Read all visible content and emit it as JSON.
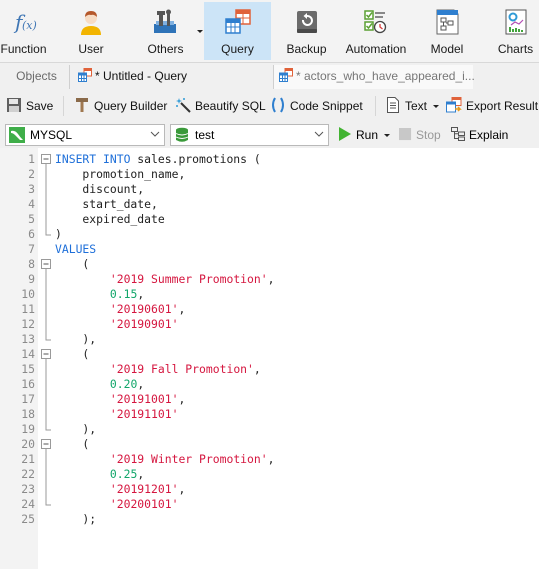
{
  "ribbon": {
    "items": [
      {
        "label": "Function",
        "icon": "function-icon"
      },
      {
        "label": "User",
        "icon": "user-icon"
      },
      {
        "label": "Others",
        "icon": "others-tools-icon"
      },
      {
        "label": "Query",
        "icon": "query-icon",
        "active": true
      },
      {
        "label": "Backup",
        "icon": "backup-icon"
      },
      {
        "label": "Automation",
        "icon": "automation-icon"
      },
      {
        "label": "Model",
        "icon": "model-icon"
      },
      {
        "label": "Charts",
        "icon": "charts-icon"
      }
    ]
  },
  "tabs": {
    "objects": "Objects",
    "untitled": "* Untitled - Query",
    "actors": "* actors_who_have_appeared_i..."
  },
  "toolbar": {
    "save": "Save",
    "query_builder": "Query Builder",
    "beautify_sql": "Beautify SQL",
    "code_snippet": "Code Snippet",
    "text": "Text",
    "export_result": "Export Result"
  },
  "connection": {
    "connection_value": "MYSQL",
    "database_value": "test",
    "run": "Run",
    "stop": "Stop",
    "explain": "Explain"
  },
  "colors": {
    "keyword": "#1e6fd9",
    "string": "#d5163f",
    "number": "#11a66a",
    "active_ribbon": "#cce4f7"
  },
  "editor": {
    "lines": [
      {
        "n": "1",
        "fold": "start",
        "tokens": [
          {
            "t": "kw",
            "v": "INSERT INTO"
          },
          {
            "t": "plain",
            "v": " sales.promotions ("
          }
        ]
      },
      {
        "n": "2",
        "fold": "line",
        "tokens": [
          {
            "t": "plain",
            "v": "    promotion_name,"
          }
        ]
      },
      {
        "n": "3",
        "fold": "line",
        "tokens": [
          {
            "t": "plain",
            "v": "    discount,"
          }
        ]
      },
      {
        "n": "4",
        "fold": "line",
        "tokens": [
          {
            "t": "plain",
            "v": "    start_date,"
          }
        ]
      },
      {
        "n": "5",
        "fold": "line",
        "tokens": [
          {
            "t": "plain",
            "v": "    expired_date"
          }
        ]
      },
      {
        "n": "6",
        "fold": "end",
        "tokens": [
          {
            "t": "plain",
            "v": ")"
          }
        ]
      },
      {
        "n": "7",
        "fold": "",
        "tokens": [
          {
            "t": "kw",
            "v": "VALUES"
          }
        ]
      },
      {
        "n": "8",
        "fold": "start",
        "tokens": [
          {
            "t": "plain",
            "v": "    ("
          }
        ]
      },
      {
        "n": "9",
        "fold": "line",
        "tokens": [
          {
            "t": "plain",
            "v": "        "
          },
          {
            "t": "str",
            "v": "'2019 Summer Promotion'"
          },
          {
            "t": "plain",
            "v": ","
          }
        ]
      },
      {
        "n": "10",
        "fold": "line",
        "tokens": [
          {
            "t": "plain",
            "v": "        "
          },
          {
            "t": "num",
            "v": "0.15"
          },
          {
            "t": "plain",
            "v": ","
          }
        ]
      },
      {
        "n": "11",
        "fold": "line",
        "tokens": [
          {
            "t": "plain",
            "v": "        "
          },
          {
            "t": "str",
            "v": "'20190601'"
          },
          {
            "t": "plain",
            "v": ","
          }
        ]
      },
      {
        "n": "12",
        "fold": "line",
        "tokens": [
          {
            "t": "plain",
            "v": "        "
          },
          {
            "t": "str",
            "v": "'20190901'"
          }
        ]
      },
      {
        "n": "13",
        "fold": "end",
        "tokens": [
          {
            "t": "plain",
            "v": "    ),"
          }
        ]
      },
      {
        "n": "14",
        "fold": "start",
        "tokens": [
          {
            "t": "plain",
            "v": "    ("
          }
        ]
      },
      {
        "n": "15",
        "fold": "line",
        "tokens": [
          {
            "t": "plain",
            "v": "        "
          },
          {
            "t": "str",
            "v": "'2019 Fall Promotion'"
          },
          {
            "t": "plain",
            "v": ","
          }
        ]
      },
      {
        "n": "16",
        "fold": "line",
        "tokens": [
          {
            "t": "plain",
            "v": "        "
          },
          {
            "t": "num",
            "v": "0.20"
          },
          {
            "t": "plain",
            "v": ","
          }
        ]
      },
      {
        "n": "17",
        "fold": "line",
        "tokens": [
          {
            "t": "plain",
            "v": "        "
          },
          {
            "t": "str",
            "v": "'20191001'"
          },
          {
            "t": "plain",
            "v": ","
          }
        ]
      },
      {
        "n": "18",
        "fold": "line",
        "tokens": [
          {
            "t": "plain",
            "v": "        "
          },
          {
            "t": "str",
            "v": "'20191101'"
          }
        ]
      },
      {
        "n": "19",
        "fold": "end",
        "tokens": [
          {
            "t": "plain",
            "v": "    ),"
          }
        ]
      },
      {
        "n": "20",
        "fold": "start",
        "tokens": [
          {
            "t": "plain",
            "v": "    ("
          }
        ]
      },
      {
        "n": "21",
        "fold": "line",
        "tokens": [
          {
            "t": "plain",
            "v": "        "
          },
          {
            "t": "str",
            "v": "'2019 Winter Promotion'"
          },
          {
            "t": "plain",
            "v": ","
          }
        ]
      },
      {
        "n": "22",
        "fold": "line",
        "tokens": [
          {
            "t": "plain",
            "v": "        "
          },
          {
            "t": "num",
            "v": "0.25"
          },
          {
            "t": "plain",
            "v": ","
          }
        ]
      },
      {
        "n": "23",
        "fold": "line",
        "tokens": [
          {
            "t": "plain",
            "v": "        "
          },
          {
            "t": "str",
            "v": "'20191201'"
          },
          {
            "t": "plain",
            "v": ","
          }
        ]
      },
      {
        "n": "24",
        "fold": "end",
        "tokens": [
          {
            "t": "plain",
            "v": "        "
          },
          {
            "t": "str",
            "v": "'20200101'"
          }
        ]
      },
      {
        "n": "25",
        "fold": "",
        "tokens": [
          {
            "t": "plain",
            "v": "    );"
          }
        ]
      }
    ]
  }
}
